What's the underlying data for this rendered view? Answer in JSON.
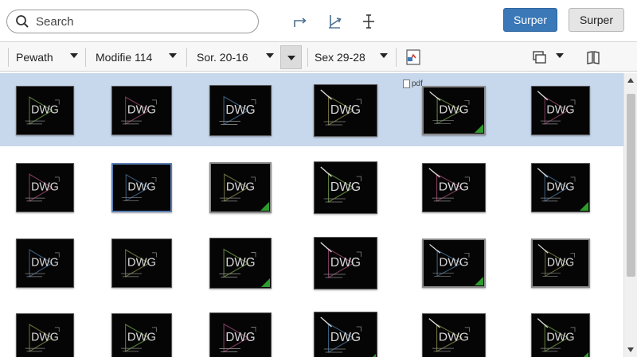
{
  "search": {
    "placeholder": "Search"
  },
  "header": {
    "primary_button": "Surper",
    "secondary_button": "Surper"
  },
  "toolbar": {
    "dropdowns": [
      {
        "label": "Pewath"
      },
      {
        "label": "Modifie 114"
      },
      {
        "label": "Sor. 20-16"
      },
      {
        "label": "Sex 29-28"
      }
    ]
  },
  "thumb_label": "DWG",
  "pdf_label": "pdf",
  "colors": {
    "accent": "#3a78b8",
    "selection": "#c7d7ec",
    "badge": "#2d9c2d"
  }
}
